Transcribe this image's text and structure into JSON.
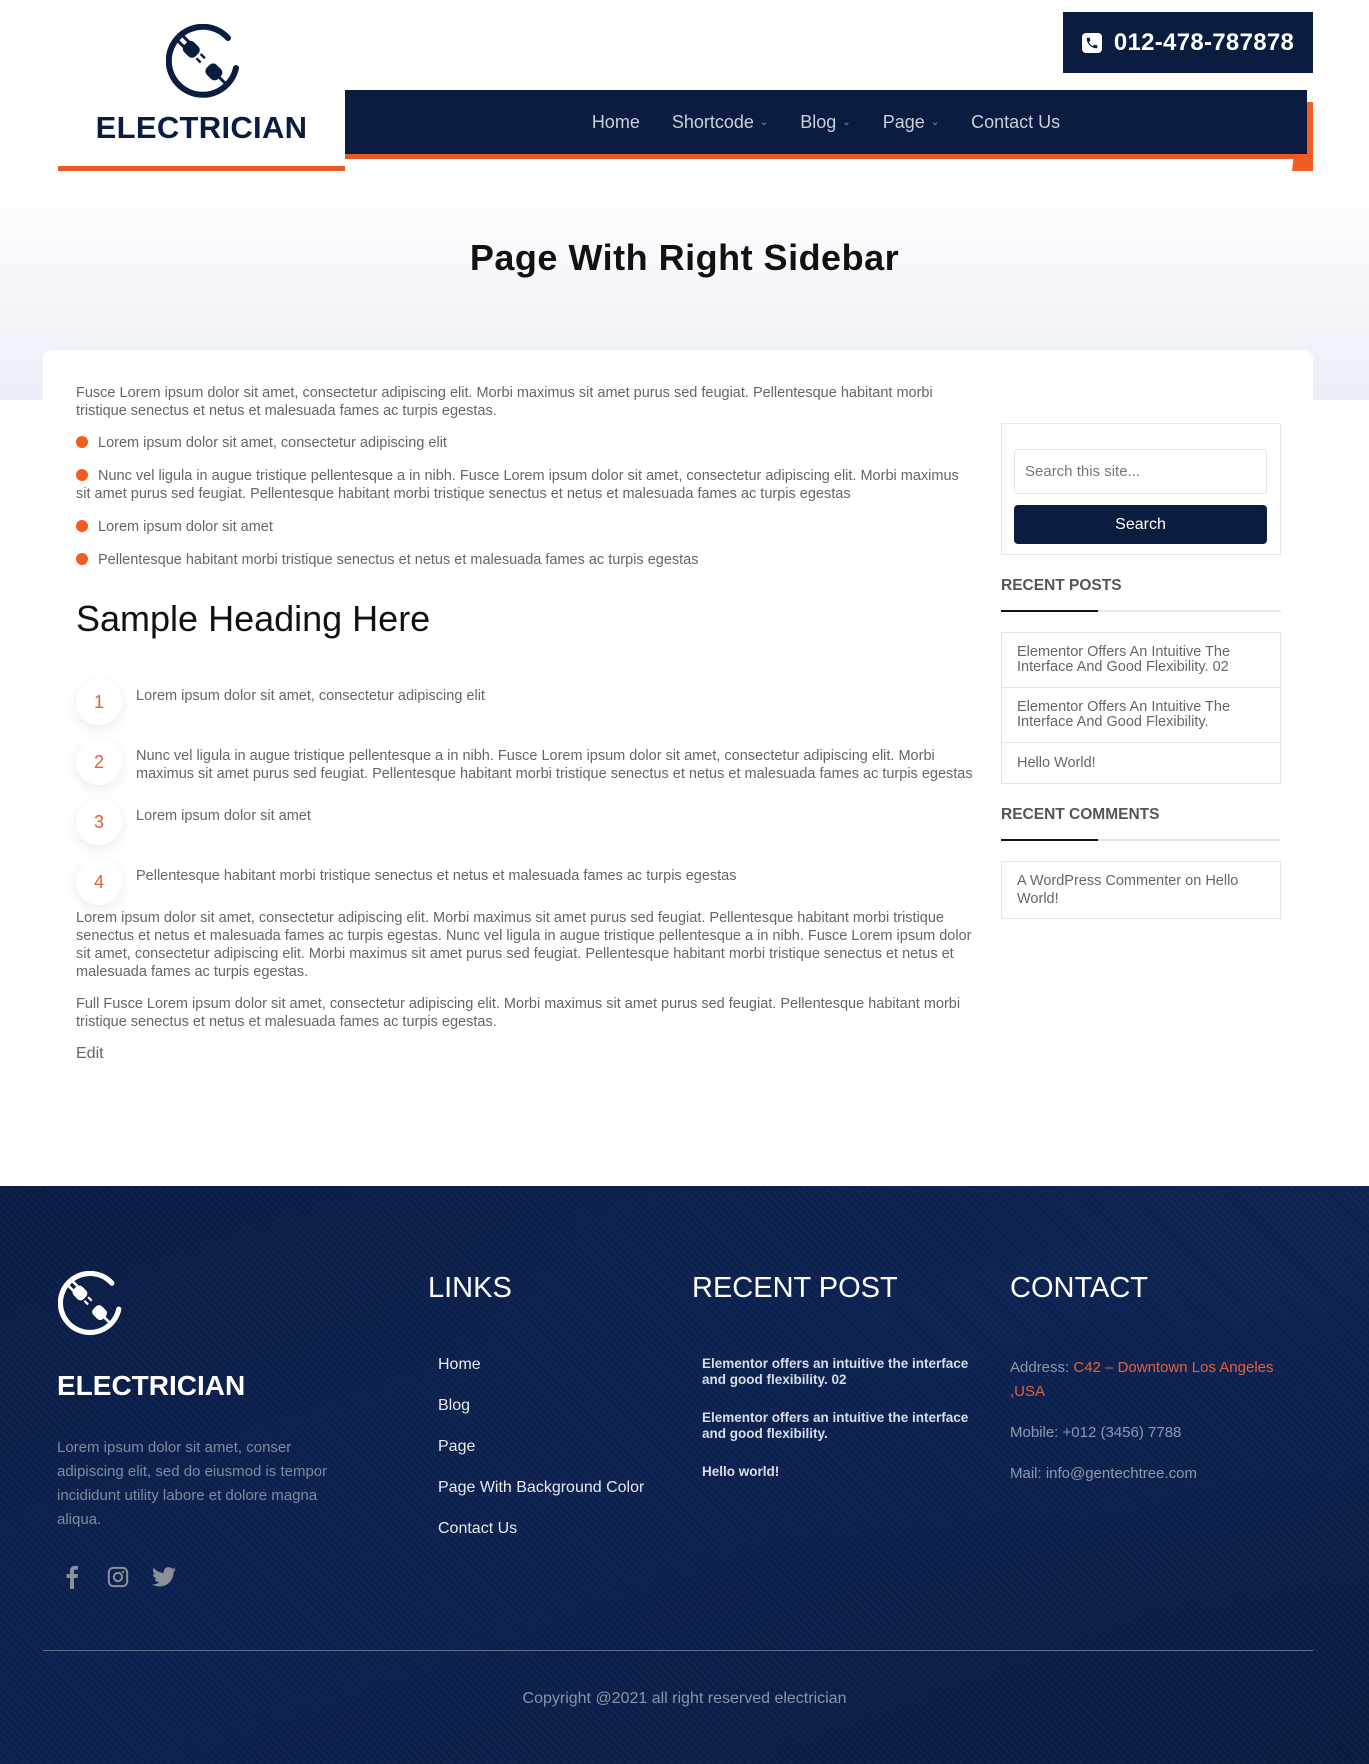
{
  "header": {
    "brand": "ELECTRICIAN",
    "phone": "012-478-787878",
    "nav": [
      {
        "label": "Home",
        "has_dropdown": false
      },
      {
        "label": "Shortcode",
        "has_dropdown": true
      },
      {
        "label": "Blog",
        "has_dropdown": true
      },
      {
        "label": "Page",
        "has_dropdown": true
      },
      {
        "label": "Contact Us",
        "has_dropdown": false
      }
    ]
  },
  "hero": {
    "title": "Page With Right Sidebar"
  },
  "content": {
    "intro": "Fusce Lorem ipsum dolor sit amet, consectetur adipiscing elit. Morbi maximus sit amet purus sed feugiat. Pellentesque habitant morbi tristique senectus et netus et malesuada fames ac turpis egestas.",
    "bullets": [
      "Lorem ipsum dolor sit amet, consectetur adipiscing elit",
      "Nunc vel ligula in augue tristique pellentesque a in nibh. Fusce Lorem ipsum dolor sit amet, consectetur adipiscing elit. Morbi maximus sit amet purus sed feugiat. Pellentesque habitant morbi tristique senectus et netus et malesuada fames ac turpis egestas",
      "Lorem ipsum dolor sit amet",
      "Pellentesque habitant morbi tristique senectus et netus et malesuada fames ac turpis egestas"
    ],
    "heading": "Sample Heading Here",
    "numbered": [
      {
        "num": "1",
        "text": "Lorem ipsum dolor sit amet, consectetur adipiscing elit"
      },
      {
        "num": "2",
        "text": "Nunc vel ligula in augue tristique pellentesque a in nibh. Fusce Lorem ipsum dolor sit amet, consectetur adipiscing elit. Morbi maximus sit amet purus sed feugiat. Pellentesque habitant morbi tristique senectus et netus et malesuada fames ac turpis egestas"
      },
      {
        "num": "3",
        "text": "Lorem ipsum dolor sit amet"
      },
      {
        "num": "4",
        "text": "Pellentesque habitant morbi tristique senectus et netus et malesuada fames ac turpis egestas"
      }
    ],
    "para1": "Lorem ipsum dolor sit amet, consectetur adipiscing elit. Morbi maximus sit amet purus sed feugiat. Pellentesque habitant morbi tristique senectus et netus et malesuada fames ac turpis egestas. Nunc vel ligula in augue tristique pellentesque a in nibh. Fusce Lorem ipsum dolor sit amet, consectetur adipiscing elit. Morbi maximus sit amet purus sed feugiat. Pellentesque habitant morbi tristique senectus et netus et malesuada fames ac turpis egestas.",
    "para2": "Full Fusce Lorem ipsum dolor sit amet, consectetur adipiscing elit. Morbi maximus sit amet purus sed feugiat. Pellentesque habitant morbi tristique senectus et netus et malesuada fames ac turpis egestas.",
    "edit_label": "Edit"
  },
  "sidebar": {
    "search_placeholder": "Search this site...",
    "search_button": "Search",
    "recent_posts_title": "RECENT POSTS",
    "recent_posts": [
      "Elementor Offers An Intuitive The Interface And Good Flexibility. 02",
      "Elementor Offers An Intuitive The Interface And Good Flexibility.",
      "Hello World!"
    ],
    "recent_comments_title": "RECENT COMMENTS",
    "recent_comments": [
      {
        "author": "A WordPress Commenter",
        "sep": " on ",
        "post": "Hello World!"
      }
    ]
  },
  "footer": {
    "brand": "ELECTRICIAN",
    "description": "Lorem ipsum dolor sit amet, conser adipiscing elit, sed do eiusmod is tempor incididunt utility labore et dolore magna aliqua.",
    "social": [
      "facebook-icon",
      "instagram-icon",
      "twitter-icon"
    ],
    "links_title": "LINKS",
    "links": [
      "Home",
      "Blog",
      "Page",
      "Page With Background Color",
      "Contact Us"
    ],
    "recent_post_title": "RECENT POST",
    "recent_posts": [
      "Elementor offers an intuitive the interface and good flexibility. 02",
      "Elementor offers an intuitive the interface and good flexibility.",
      "Hello world!"
    ],
    "contact_title": "CONTACT",
    "address_label": "Address: ",
    "address_value": "C42 – Downtown Los Angeles ,USA",
    "mobile": "Mobile: +012 (3456) 7788",
    "mail": "Mail: info@gentechtree.com",
    "copyright": "Copyright @2021 all right reserved electrician"
  },
  "colors": {
    "navy": "#0a1c3f",
    "accent_orange": "#e65a27",
    "footer_address": "#e6603c"
  }
}
